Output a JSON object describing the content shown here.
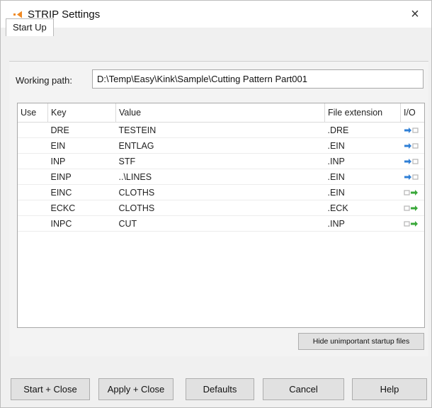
{
  "window": {
    "title": "STRIP Settings",
    "close_glyph": "×"
  },
  "tabs": [
    {
      "label": "Start Up",
      "selected": true
    }
  ],
  "working_path": {
    "label": "Working path:",
    "value": "D:\\Temp\\Easy\\Kink\\Sample\\Cutting Pattern Part001"
  },
  "table": {
    "headers": [
      "Use",
      "Key",
      "Value",
      "File extension",
      "I/O"
    ],
    "rows": [
      {
        "key": "DRE",
        "value": "TESTEIN",
        "ext": ".DRE",
        "io": "input"
      },
      {
        "key": "EIN",
        "value": "ENTLAG",
        "ext": ".EIN",
        "io": "input"
      },
      {
        "key": "INP",
        "value": "STF",
        "ext": ".INP",
        "io": "input"
      },
      {
        "key": "EINP",
        "value": "..\\LINES",
        "ext": ".EIN",
        "io": "input"
      },
      {
        "key": "EINC",
        "value": "CLOTHS",
        "ext": ".EIN",
        "io": "output"
      },
      {
        "key": "ECKC",
        "value": "CLOTHS",
        "ext": ".ECK",
        "io": "output"
      },
      {
        "key": "INPC",
        "value": "CUT",
        "ext": ".INP",
        "io": "output"
      }
    ]
  },
  "hide_button": "Hide unimportant startup files",
  "buttons": {
    "start_close": "Start + Close",
    "apply_close": "Apply + Close",
    "defaults": "Defaults",
    "cancel": "Cancel",
    "help": "Help"
  },
  "icons": {
    "app": "strip-app-icon",
    "close": "close-icon",
    "io_input": "arrow-into-file-icon",
    "io_output": "arrow-out-of-file-icon"
  },
  "colors": {
    "accent_orange": "#f08a24",
    "io_input_arrow": "#2f7fd6",
    "io_output_arrow": "#3aa83a",
    "io_file_gray": "#b5b5b5"
  }
}
